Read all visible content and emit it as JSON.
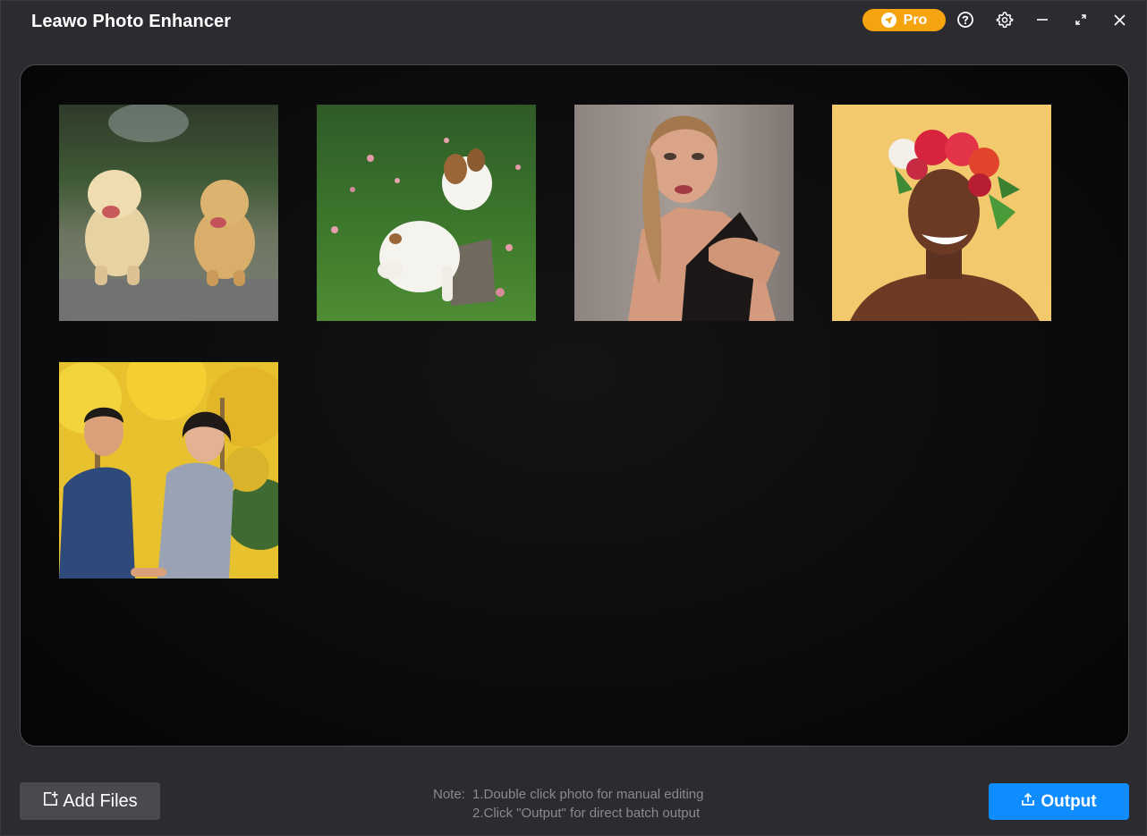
{
  "app": {
    "title": "Leawo Photo Enhancer"
  },
  "titlebar": {
    "pro_label": "Pro",
    "icons": [
      "rocket-icon",
      "help-icon",
      "gear-icon",
      "minimize-icon",
      "maximize-icon",
      "close-icon"
    ]
  },
  "gallery": {
    "photos": [
      {
        "subject": "two puppies walking"
      },
      {
        "subject": "white puppy on grass"
      },
      {
        "subject": "woman with ponytail"
      },
      {
        "subject": "woman with flower crown"
      },
      {
        "subject": "couple in autumn park"
      }
    ]
  },
  "footer": {
    "add_files_label": "Add Files",
    "note_prefix": "Note:",
    "note_line1": "1.Double click photo for manual editing",
    "note_line2": "2.Click \"Output\" for direct batch output",
    "output_label": "Output"
  },
  "colors": {
    "accent_blue": "#0f8cff",
    "pro_orange": "#f5a30f",
    "background": "#2c2c30"
  }
}
